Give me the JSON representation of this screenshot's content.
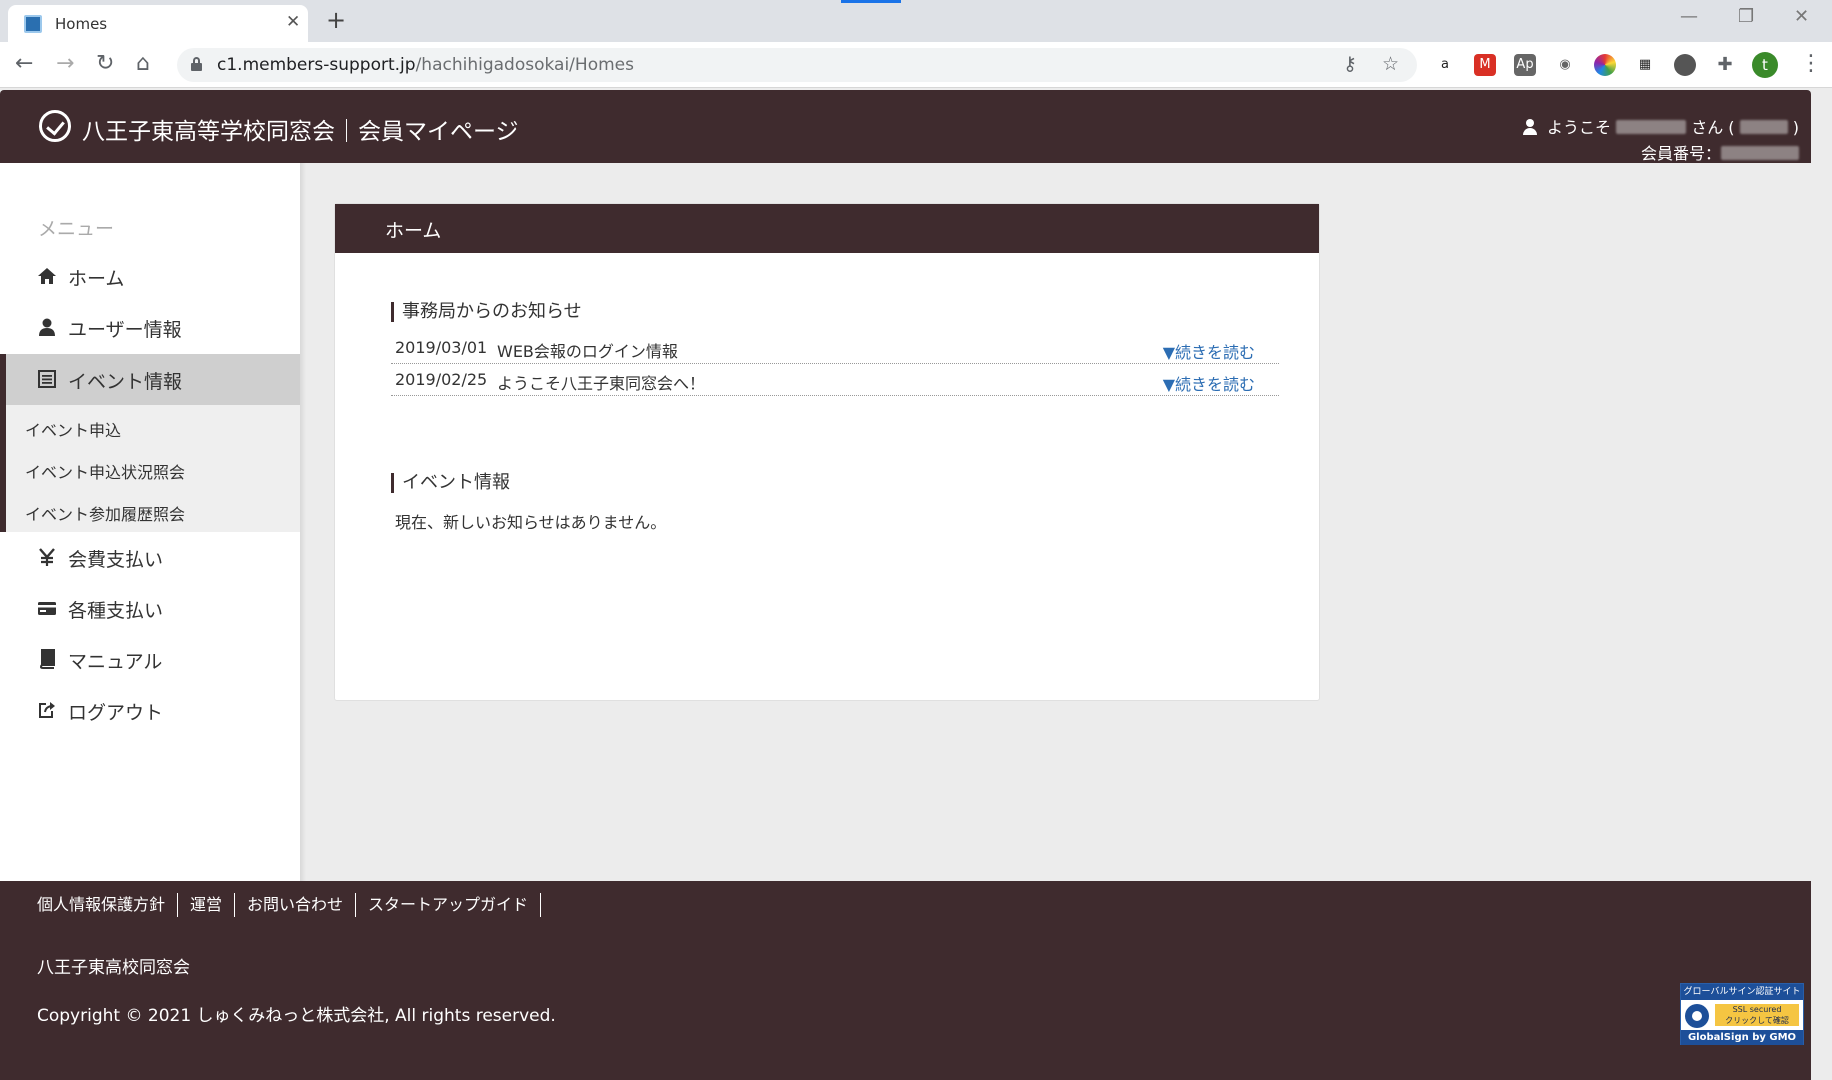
{
  "browser": {
    "tab_title": "Homes",
    "url_host": "c1.members-support.jp",
    "url_path": "/hachihigadosokai/Homes",
    "profile_initial": "t"
  },
  "header": {
    "title": "八王子東高等学校同窓会｜会員マイページ",
    "welcome_prefix": "ようこそ",
    "welcome_suffix": "さん (",
    "welcome_close": ")",
    "member_no_label": "会員番号："
  },
  "sidebar": {
    "heading": "メニュー",
    "items": [
      {
        "label": "ホーム",
        "icon": "home-icon"
      },
      {
        "label": "ユーザー情報",
        "icon": "user-icon"
      },
      {
        "label": "イベント情報",
        "icon": "list-icon",
        "active": true
      },
      {
        "label": "会費支払い",
        "icon": "yen-icon"
      },
      {
        "label": "各種支払い",
        "icon": "card-icon"
      },
      {
        "label": "マニュアル",
        "icon": "book-icon"
      },
      {
        "label": "ログアウト",
        "icon": "logout-icon"
      }
    ],
    "subitems": [
      "イベント申込",
      "イベント申込状況照会",
      "イベント参加履歴照会"
    ]
  },
  "main": {
    "title": "ホーム",
    "news_heading": "事務局からのお知らせ",
    "news": [
      {
        "date": "2019/03/01",
        "text": "WEB会報のログイン情報",
        "more": "▼続きを読む"
      },
      {
        "date": "2019/02/25",
        "text": "ようこそ八王子東同窓会へ！",
        "more": "▼続きを読む"
      }
    ],
    "event_heading": "イベント情報",
    "event_empty": "現在、新しいお知らせはありません。"
  },
  "footer": {
    "links": [
      "個人情報保護方針",
      "運営",
      "お問い合わせ",
      "スタートアップガイド"
    ],
    "org": "八王子東高校同窓会",
    "copyright": "Copyright © 2021 しゅくみねっと株式会社, All rights reserved.",
    "ssl_top": "グローバルサイン認証サイト",
    "ssl_mid_1": "SSL secured",
    "ssl_mid_2": "クリックして確認",
    "ssl_bottom": "GlobalSign by GMO"
  },
  "colors": {
    "brand": "#3f2b2e",
    "link": "#2c6db3",
    "active_menu_bg": "#cfcfcf"
  }
}
